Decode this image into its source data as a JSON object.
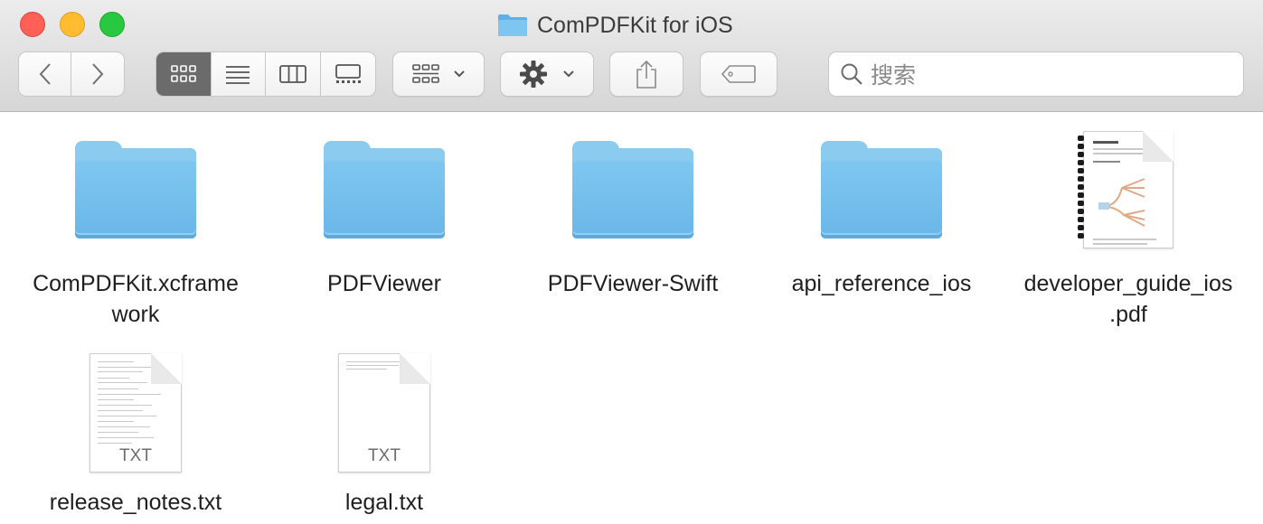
{
  "window": {
    "title": "ComPDFKit for iOS",
    "controls": [
      "close",
      "minimize",
      "zoom"
    ]
  },
  "toolbar": {
    "nav": {
      "back_icon": "chevron-left-icon",
      "forward_icon": "chevron-right-icon"
    },
    "view_modes": [
      {
        "name": "icon-view",
        "icon": "grid-icon",
        "active": true
      },
      {
        "name": "list-view",
        "icon": "list-icon",
        "active": false
      },
      {
        "name": "column-view",
        "icon": "columns-icon",
        "active": false
      },
      {
        "name": "gallery-view",
        "icon": "gallery-icon",
        "active": false
      }
    ],
    "group_icon": "group-grid-icon",
    "action_icon": "gear-icon",
    "share_icon": "share-icon",
    "tag_icon": "tag-icon",
    "search": {
      "placeholder": "搜索"
    }
  },
  "files": [
    {
      "name": "ComPDFKit.xcframe\nwork",
      "kind": "folder"
    },
    {
      "name": "PDFViewer",
      "kind": "folder"
    },
    {
      "name": "PDFViewer-Swift",
      "kind": "folder"
    },
    {
      "name": "api_reference_ios",
      "kind": "folder"
    },
    {
      "name": "developer_guide_ios\n.pdf",
      "kind": "pdf"
    },
    {
      "name": "release_notes.txt",
      "kind": "txt",
      "badge": "TXT"
    },
    {
      "name": "legal.txt",
      "kind": "txt",
      "badge": "TXT"
    }
  ],
  "colors": {
    "folder": "#7fc7f1",
    "active_segment": "#6b6b6b",
    "close": "#fe5f57",
    "minimize": "#febc2e",
    "zoom": "#28c840"
  }
}
